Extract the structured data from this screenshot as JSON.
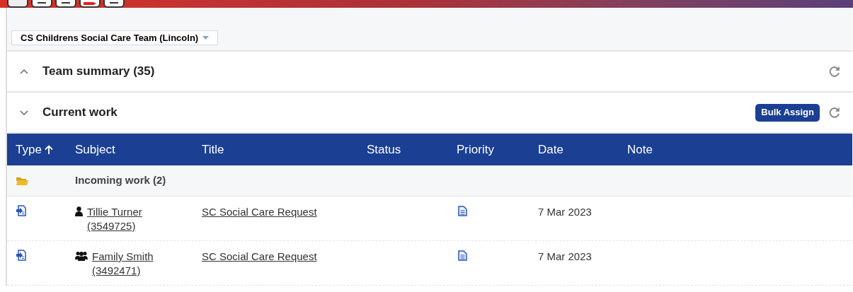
{
  "team_selector": {
    "value": "CS Childrens Social Care Team (Lincoln)"
  },
  "sections": [
    {
      "title": "Team summary (35)",
      "expanded": false
    },
    {
      "title": "Current work",
      "expanded": true,
      "action": "Bulk Assign"
    }
  ],
  "table": {
    "columns": [
      {
        "label": "Type",
        "sorted": true
      },
      {
        "label": "Subject",
        "sorted": false
      },
      {
        "label": "Title",
        "sorted": false
      },
      {
        "label": "Status",
        "sorted": false
      },
      {
        "label": "Priority",
        "sorted": false
      },
      {
        "label": "Date",
        "sorted": false
      },
      {
        "label": "Note",
        "sorted": false
      }
    ],
    "groups": [
      {
        "label": "Incoming work (2)",
        "rows": [
          {
            "kind": "person",
            "subject": "Tillie Turner (3549725)",
            "title": "SC Social Care Request",
            "date": "7 Mar 2023"
          },
          {
            "kind": "family",
            "subject": "Family Smith (3492471)",
            "title": "SC Social Care Request",
            "date": "7 Mar 2023"
          }
        ]
      }
    ]
  }
}
